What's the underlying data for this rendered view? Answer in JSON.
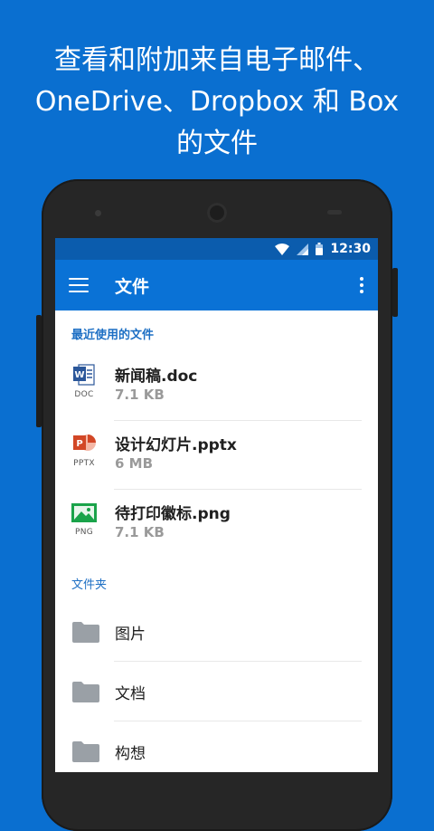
{
  "promo": {
    "line1": "查看和附加来自电子邮件、",
    "line2": "OneDrive、Dropbox 和 Box",
    "line3": "的文件"
  },
  "status_bar": {
    "time": "12:30"
  },
  "app_bar": {
    "title": "文件"
  },
  "recent_section": {
    "label": "最近使用的文件"
  },
  "recent_files": [
    {
      "name": "新闻稿.doc",
      "size": "7.1 KB",
      "type_label": "DOC",
      "icon": "word-doc-icon"
    },
    {
      "name": "设计幻灯片.pptx",
      "size": "6 MB",
      "type_label": "PPTX",
      "icon": "powerpoint-icon"
    },
    {
      "name": "待打印徽标.png",
      "size": "7.1 KB",
      "type_label": "PNG",
      "icon": "image-file-icon"
    }
  ],
  "folders_section": {
    "label": "文件夹"
  },
  "folders": [
    {
      "name": "图片",
      "icon": "folder-icon"
    },
    {
      "name": "文档",
      "icon": "folder-icon"
    },
    {
      "name": "构想",
      "icon": "folder-icon"
    }
  ],
  "colors": {
    "background": "#0a6fd0",
    "status_bar": "#0b5cad",
    "app_bar": "#0a72d6",
    "section_label": "#1d6fc4",
    "word": "#2b579a",
    "powerpoint": "#d24726",
    "png": "#1aa34a"
  }
}
